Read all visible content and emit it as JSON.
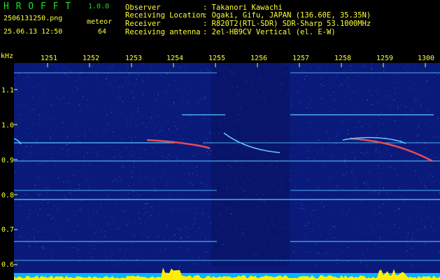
{
  "app": {
    "name": "H R O F F T",
    "version": "1.0.0",
    "file_name": "2506131250.png",
    "timestamp": "25.06.13 12:50",
    "meteor_label": "meteor",
    "meteor_count": "64"
  },
  "info": {
    "observer_label": "Observer",
    "observer_value": ": Takanori Kawachi",
    "location_label": "Receiving Location",
    "location_value": ": Ogaki, Gifu, JAPAN (136.60E, 35.35N)",
    "receiver_label": "Receiver",
    "receiver_value": ": R820T2(RTL-SDR) SDR-Sharp 53.1000MHz",
    "antenna_label": "Receiving antenna",
    "antenna_value": ": 2el-HB9CV Vertical (el. E-W)"
  },
  "axes": {
    "y_unit": "kHz",
    "x_ticks": [
      "1251",
      "1252",
      "1253",
      "1254",
      "1255",
      "1256",
      "1257",
      "1258",
      "1259",
      "1300"
    ],
    "y_ticks": [
      "1.1",
      "1.0",
      "0.9",
      "0.8",
      "0.7",
      "0.6"
    ]
  },
  "colors": {
    "background": "#000000",
    "spectrum_noise": "#0a1a7a",
    "carrier_lines": "#55c8ff",
    "meteor_trace": "#ff5050",
    "signal_bar": "#ffee00",
    "label_text": "#ffff33",
    "title_text": "#22dd22"
  }
}
